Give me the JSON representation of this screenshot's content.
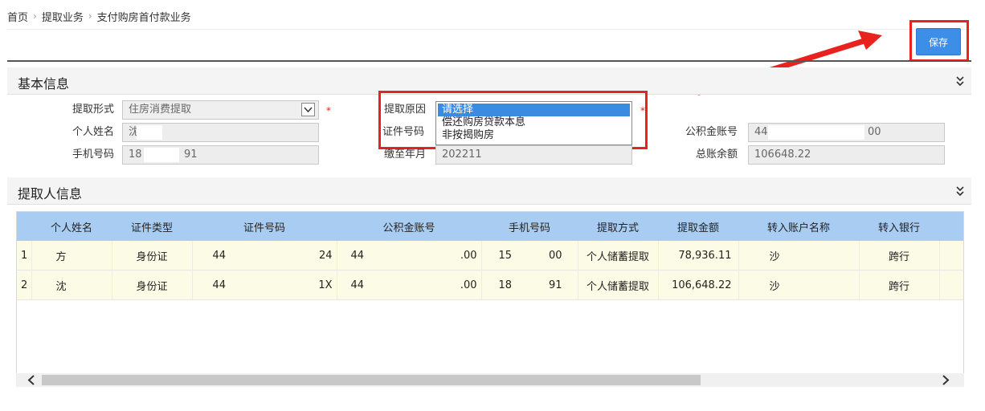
{
  "breadcrumb": {
    "items": [
      "首页",
      "提取业务",
      "支付购房首付款业务"
    ],
    "separator": "›"
  },
  "toolbar": {
    "save_label": "保存"
  },
  "basic_info": {
    "title": "基本信息",
    "withdrawal_form": {
      "label": "提取形式",
      "value": "住房消费提取"
    },
    "withdrawal_reason": {
      "label": "提取原因",
      "options": [
        "请选择",
        "偿还购房贷款本息",
        "非按揭购房"
      ],
      "selected": "请选择"
    },
    "person_name": {
      "label": "个人姓名",
      "value": "沈"
    },
    "id_number": {
      "label": "证件号码"
    },
    "fund_account": {
      "label": "公积金账号",
      "value_start": "44",
      "value_end": "00"
    },
    "mobile": {
      "label": "手机号码",
      "value_start": "18",
      "value_end": "91"
    },
    "paid_until": {
      "label": "缴至年月",
      "value": "202211"
    },
    "total_balance": {
      "label": "总账余额",
      "value": "106648.22"
    },
    "required_mark": "*"
  },
  "withdrawer_info": {
    "title": "提取人信息",
    "columns": [
      "个人姓名",
      "证件类型",
      "证件号码",
      "公积金账号",
      "手机号码",
      "提取方式",
      "提取金额",
      "转入账户名称",
      "转入银行"
    ],
    "rows": [
      {
        "no": "1",
        "name": "方",
        "id_type": "身份证",
        "id_start": "44",
        "id_end": "24",
        "acct_start": "44",
        "acct_end": ".00",
        "phone_start": "15",
        "phone_end": "00",
        "method": "个人储蓄提取",
        "amount": "78,936.11",
        "account_name": "沙",
        "bank": "跨行"
      },
      {
        "no": "2",
        "name": "沈",
        "id_type": "身份证",
        "id_start": "44",
        "id_end": "1X",
        "acct_start": "44",
        "acct_end": ".00",
        "phone_start": "18",
        "phone_end": "91",
        "method": "个人储蓄提取",
        "amount": "106,648.22",
        "account_name": "沙",
        "bank": "跨行"
      }
    ]
  },
  "colors": {
    "save_button": "#3c8ee6",
    "highlight_red": "#e8231f",
    "table_header": "#a9cdf2",
    "row_background": "#fcfce6",
    "selected_option": "#3b8be3"
  },
  "icons": {
    "section_toggle": "double-chevron-down-icon",
    "select_arrow": "chevron-down-icon",
    "scroll_left": "chevron-left-icon",
    "scroll_right": "chevron-right-icon"
  }
}
